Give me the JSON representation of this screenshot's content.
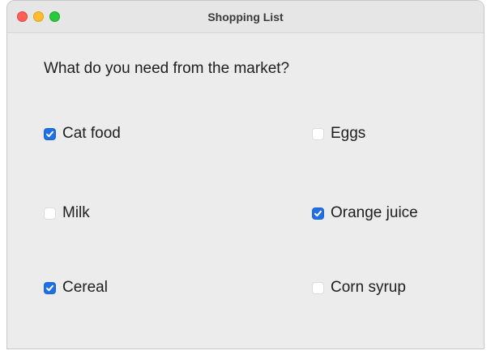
{
  "window": {
    "title": "Shopping List"
  },
  "prompt": "What do you need from the market?",
  "items": [
    {
      "label": "Cat food",
      "checked": true
    },
    {
      "label": "Eggs",
      "checked": false
    },
    {
      "label": "Milk",
      "checked": false
    },
    {
      "label": "Orange juice",
      "checked": true
    },
    {
      "label": "Cereal",
      "checked": true
    },
    {
      "label": "Corn syrup",
      "checked": false
    }
  ],
  "colors": {
    "checkbox_checked": "#1f6fe5",
    "window_background": "#ececec",
    "traffic_close": "#ff5f57",
    "traffic_minimize": "#febc2e",
    "traffic_zoom": "#28c840"
  }
}
